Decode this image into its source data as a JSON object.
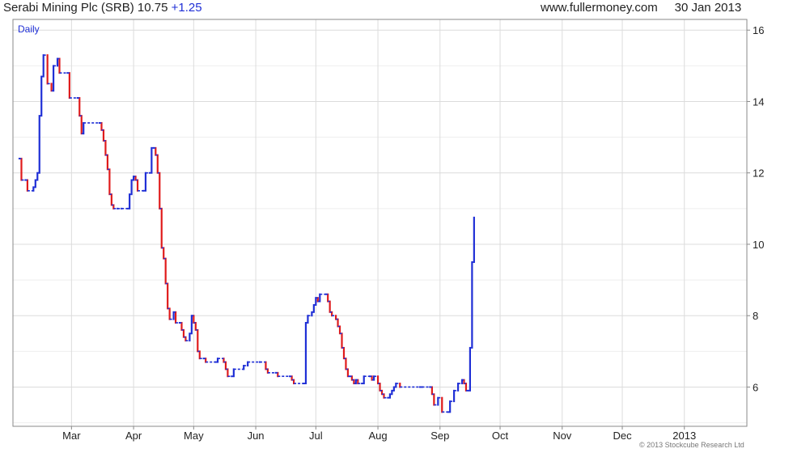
{
  "header": {
    "symbol_text": "Serabi Mining Plc (SRB) 10.75",
    "change": "+1.25",
    "site": "www.fullermoney.com",
    "date": "30 Jan 2013"
  },
  "footer": {
    "copyright": "© 2013 Stockcube Research Ltd"
  },
  "colors": {
    "up": "#1f2fd6",
    "down": "#e01b1b",
    "grid": "#dcdcdc"
  },
  "chart_data": {
    "type": "bar",
    "subtype": "price-bars",
    "title": "Serabi Mining Plc (SRB) 10.75 +1.25",
    "period_label": "Daily",
    "xlabel": "",
    "ylabel": "",
    "ylim": [
      4.9,
      16.3
    ],
    "y_ticks": [
      6,
      8,
      10,
      12,
      14,
      16
    ],
    "x_range_days": [
      0,
      362
    ],
    "x_ticks": [
      {
        "label": "Mar",
        "day": 26
      },
      {
        "label": "Apr",
        "day": 57
      },
      {
        "label": "May",
        "day": 87
      },
      {
        "label": "Jun",
        "day": 118
      },
      {
        "label": "Jul",
        "day": 148
      },
      {
        "label": "Aug",
        "day": 179
      },
      {
        "label": "Sep",
        "day": 210
      },
      {
        "label": "Oct",
        "day": 240
      },
      {
        "label": "Nov",
        "day": 271
      },
      {
        "label": "Dec",
        "day": 301
      },
      {
        "label": "2013",
        "day": 332
      }
    ],
    "grid": true,
    "y_axis_side": "right",
    "points": [
      [
        0,
        12.4
      ],
      [
        1,
        11.8
      ],
      [
        3,
        11.8
      ],
      [
        4,
        11.5
      ],
      [
        7,
        11.6
      ],
      [
        8,
        11.8
      ],
      [
        9,
        12.0
      ],
      [
        10,
        13.6
      ],
      [
        11,
        14.7
      ],
      [
        12,
        15.3
      ],
      [
        14,
        14.5
      ],
      [
        16,
        14.3
      ],
      [
        17,
        15.0
      ],
      [
        19,
        15.2
      ],
      [
        20,
        14.8
      ],
      [
        24,
        14.8
      ],
      [
        25,
        14.1
      ],
      [
        29,
        14.1
      ],
      [
        30,
        13.6
      ],
      [
        31,
        13.1
      ],
      [
        32,
        13.4
      ],
      [
        40,
        13.4
      ],
      [
        41,
        13.2
      ],
      [
        42,
        12.9
      ],
      [
        43,
        12.5
      ],
      [
        44,
        12.1
      ],
      [
        45,
        11.4
      ],
      [
        46,
        11.1
      ],
      [
        47,
        11.0
      ],
      [
        49,
        11.0
      ],
      [
        51,
        11.0
      ],
      [
        54,
        11.0
      ],
      [
        55,
        11.4
      ],
      [
        56,
        11.8
      ],
      [
        57,
        11.9
      ],
      [
        58,
        11.8
      ],
      [
        59,
        11.5
      ],
      [
        62,
        11.5
      ],
      [
        63,
        12.0
      ],
      [
        65,
        12.0
      ],
      [
        66,
        12.7
      ],
      [
        67,
        12.7
      ],
      [
        68,
        12.5
      ],
      [
        69,
        12.0
      ],
      [
        70,
        11.0
      ],
      [
        71,
        9.9
      ],
      [
        72,
        9.6
      ],
      [
        73,
        8.9
      ],
      [
        74,
        8.2
      ],
      [
        75,
        7.9
      ],
      [
        77,
        8.1
      ],
      [
        78,
        7.8
      ],
      [
        80,
        7.8
      ],
      [
        81,
        7.6
      ],
      [
        82,
        7.4
      ],
      [
        83,
        7.3
      ],
      [
        85,
        7.5
      ],
      [
        86,
        8.0
      ],
      [
        87,
        7.8
      ],
      [
        88,
        7.6
      ],
      [
        89,
        7.0
      ],
      [
        90,
        6.8
      ],
      [
        92,
        6.8
      ],
      [
        93,
        6.7
      ],
      [
        98,
        6.7
      ],
      [
        99,
        6.8
      ],
      [
        102,
        6.7
      ],
      [
        103,
        6.5
      ],
      [
        104,
        6.3
      ],
      [
        106,
        6.3
      ],
      [
        107,
        6.5
      ],
      [
        112,
        6.6
      ],
      [
        114,
        6.7
      ],
      [
        120,
        6.7
      ],
      [
        123,
        6.5
      ],
      [
        124,
        6.4
      ],
      [
        128,
        6.4
      ],
      [
        129,
        6.3
      ],
      [
        135,
        6.3
      ],
      [
        136,
        6.2
      ],
      [
        137,
        6.1
      ],
      [
        142,
        6.1
      ],
      [
        143,
        7.8
      ],
      [
        144,
        8.0
      ],
      [
        146,
        8.1
      ],
      [
        147,
        8.3
      ],
      [
        148,
        8.5
      ],
      [
        149,
        8.4
      ],
      [
        150,
        8.6
      ],
      [
        153,
        8.6
      ],
      [
        154,
        8.4
      ],
      [
        155,
        8.1
      ],
      [
        156,
        8.0
      ],
      [
        158,
        7.9
      ],
      [
        159,
        7.7
      ],
      [
        160,
        7.5
      ],
      [
        161,
        7.1
      ],
      [
        162,
        6.8
      ],
      [
        163,
        6.5
      ],
      [
        164,
        6.3
      ],
      [
        165,
        6.3
      ],
      [
        166,
        6.2
      ],
      [
        167,
        6.1
      ],
      [
        168,
        6.2
      ],
      [
        169,
        6.1
      ],
      [
        171,
        6.1
      ],
      [
        172,
        6.3
      ],
      [
        175,
        6.3
      ],
      [
        176,
        6.2
      ],
      [
        177,
        6.3
      ],
      [
        179,
        6.1
      ],
      [
        180,
        5.9
      ],
      [
        181,
        5.8
      ],
      [
        182,
        5.7
      ],
      [
        184,
        5.7
      ],
      [
        185,
        5.8
      ],
      [
        186,
        5.9
      ],
      [
        187,
        6.0
      ],
      [
        188,
        6.1
      ],
      [
        190,
        6.0
      ],
      [
        200,
        6.0
      ],
      [
        201,
        6.0
      ],
      [
        205,
        6.0
      ],
      [
        206,
        5.8
      ],
      [
        207,
        5.5
      ],
      [
        209,
        5.7
      ],
      [
        211,
        5.3
      ],
      [
        214,
        5.3
      ],
      [
        215,
        5.6
      ],
      [
        217,
        5.9
      ],
      [
        219,
        6.1
      ],
      [
        221,
        6.2
      ],
      [
        222,
        6.1
      ],
      [
        223,
        5.9
      ],
      [
        224,
        5.9
      ],
      [
        225,
        7.1
      ],
      [
        226,
        9.5
      ],
      [
        227,
        10.75
      ]
    ]
  }
}
